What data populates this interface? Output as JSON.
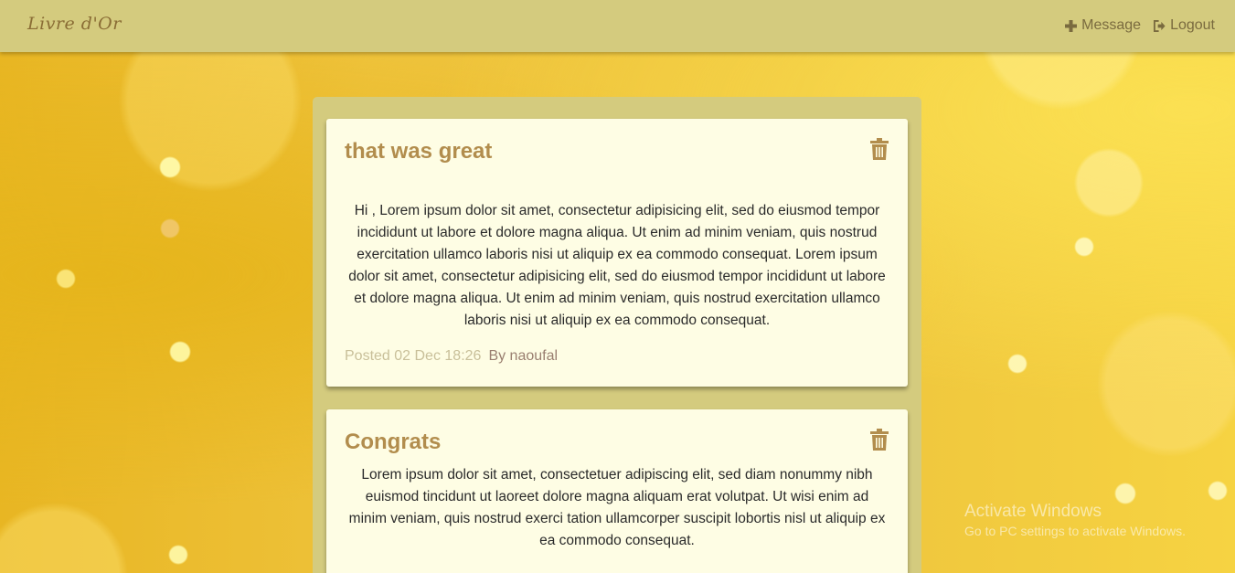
{
  "navbar": {
    "brand": "Livre d'Or",
    "links": [
      {
        "label": "Message",
        "icon": "plus-icon"
      },
      {
        "label": "Logout",
        "icon": "logout-icon"
      }
    ]
  },
  "messages": [
    {
      "title": "that was great",
      "body": "Hi , Lorem ipsum dolor sit amet, consectetur adipisicing elit, sed do eiusmod tempor incididunt ut labore et dolore magna aliqua. Ut enim ad minim veniam, quis nostrud exercitation ullamco laboris nisi ut aliquip ex ea commodo consequat. Lorem ipsum dolor sit amet, consectetur adipisicing elit, sed do eiusmod tempor incididunt ut labore et dolore magna aliqua. Ut enim ad minim veniam, quis nostrud exercitation ullamco laboris nisi ut aliquip ex ea commodo consequat.",
      "posted": "Posted 02 Dec 18:26",
      "author": "By naoufal",
      "delete_icon": "trash-icon"
    },
    {
      "title": "Congrats",
      "body": "Lorem ipsum dolor sit amet, consectetuer adipiscing elit, sed diam nonummy nibh euismod tincidunt ut laoreet dolore magna aliquam erat volutpat. Ut wisi enim ad minim veniam, quis nostrud exerci tation ullamcorper suscipit lobortis nisl ut aliquip ex ea commodo consequat.",
      "delete_icon": "trash-icon"
    }
  ],
  "watermark": {
    "title": "Activate Windows",
    "subtitle": "Go to PC settings to activate Windows."
  },
  "colors": {
    "navbar": "#d4cb7e",
    "card": "#fefde4",
    "title": "#b28d4d",
    "background": "#eec23a"
  }
}
